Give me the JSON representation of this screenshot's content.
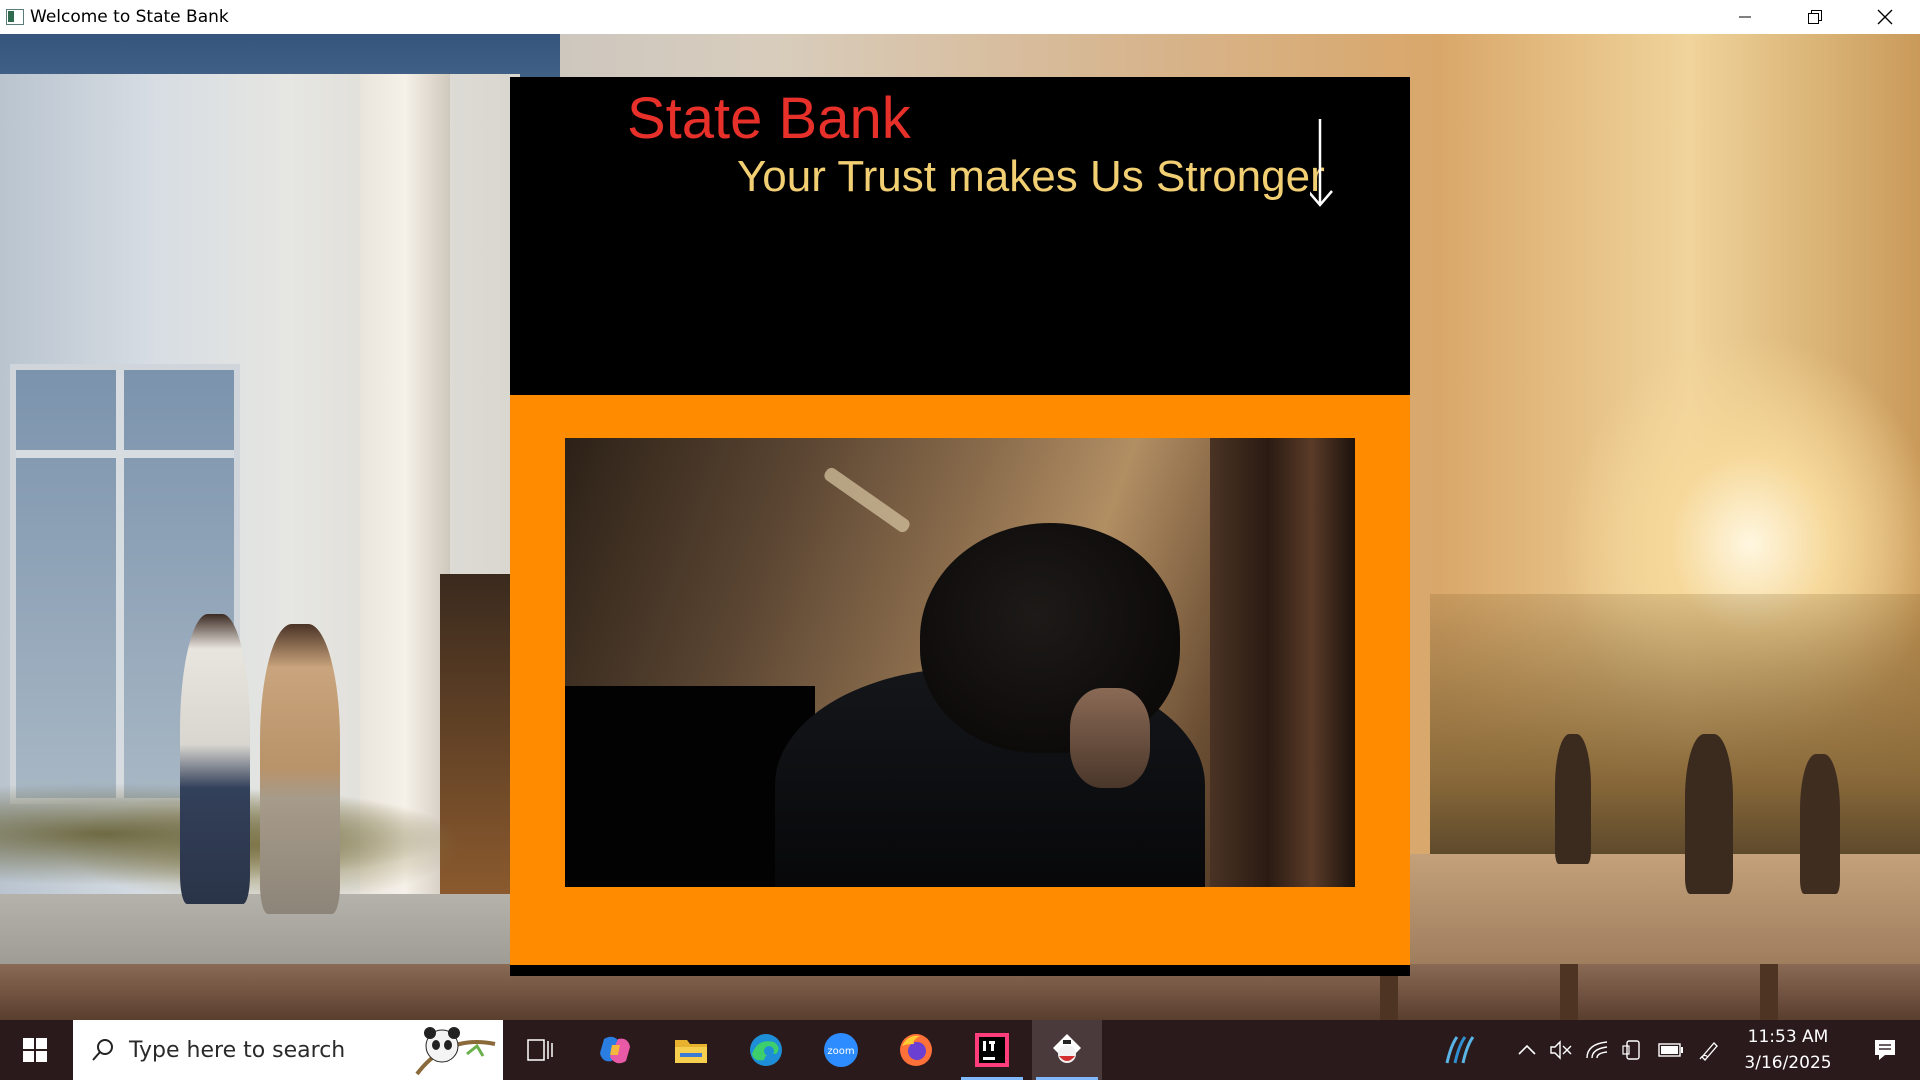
{
  "window": {
    "title": "Welcome to State Bank",
    "controls": {
      "minimize_icon": "minimize-icon",
      "restore_icon": "restore-icon",
      "close_icon": "close-icon"
    }
  },
  "panel": {
    "brand": "State Bank",
    "tagline": "Your Trust makes Us Stronger",
    "colors": {
      "brand": "#e8302a",
      "tagline": "#f2cf72",
      "frame": "#ff8c00",
      "background": "#000000"
    }
  },
  "taskbar": {
    "search_placeholder": "Type here to search",
    "apps": [
      "task-view-icon",
      "copilot-icon",
      "file-explorer-icon",
      "edge-icon",
      "zoom-icon",
      "firefox-icon",
      "intellij-icon",
      "java-icon"
    ],
    "tray_icons": [
      "weather-icon",
      "chevron-up-icon",
      "volume-muted-icon",
      "wifi-icon",
      "phone-link-icon",
      "battery-icon",
      "pen-icon",
      "notification-icon"
    ],
    "time": "11:53 AM",
    "date": "3/16/2025"
  }
}
